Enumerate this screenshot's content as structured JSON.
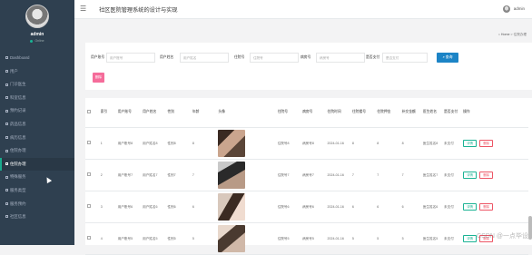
{
  "sidebar": {
    "profile": {
      "name": "admin",
      "status": "Online"
    },
    "items": [
      {
        "label": "Dashboard",
        "icon": "dashboard-icon"
      },
      {
        "label": "用户",
        "icon": "user-icon"
      },
      {
        "label": "门诊医生",
        "icon": "doctor-icon"
      },
      {
        "label": "科室信息",
        "icon": "building-icon"
      },
      {
        "label": "预约记录",
        "icon": "calendar-icon"
      },
      {
        "label": "药品信息",
        "icon": "medicine-icon"
      },
      {
        "label": "病历信息",
        "icon": "record-icon"
      },
      {
        "label": "住院办理",
        "icon": "bed-icon"
      },
      {
        "label": "住院办理",
        "icon": "bed-icon",
        "active": true
      },
      {
        "label": "特殊服务",
        "icon": "service-icon"
      },
      {
        "label": "服务类型",
        "icon": "list-icon"
      },
      {
        "label": "服务预约",
        "icon": "booking-icon"
      },
      {
        "label": "社区信息",
        "icon": "info-icon"
      }
    ]
  },
  "topbar": {
    "title": "社区医院管理系统的设计与实现",
    "user": "admin"
  },
  "breadcrumb": {
    "home": "Home",
    "current": "住院办理"
  },
  "search": {
    "fields": [
      {
        "label": "用户账号",
        "placeholder": "用户账号"
      },
      {
        "label": "用户姓名",
        "placeholder": "用户姓名"
      },
      {
        "label": "住院号",
        "placeholder": "住院号"
      },
      {
        "label": "病房号",
        "placeholder": "病房号"
      },
      {
        "label": "是否支付",
        "placeholder": "是否支付"
      }
    ],
    "search_label": "查询",
    "delete_label": "删除"
  },
  "table": {
    "headers": [
      "索引",
      "用户账号",
      "用户姓名",
      "性别",
      "年龄",
      "头像",
      "住院号",
      "病房号",
      "住院时间",
      "住院楼号",
      "住院押金",
      "补交金额",
      "医生姓名",
      "是否支付",
      "操作"
    ],
    "rows": [
      {
        "index": "1",
        "account": "用户账号8",
        "name": "用户姓名8",
        "gender": "性别8",
        "age": "8",
        "inpatient_no": "住院号8",
        "ward": "病房号8",
        "date": "2024-01-16",
        "building": "8",
        "deposit": "8",
        "extra": "8",
        "doctor": "医生姓名8",
        "paid": "未支付"
      },
      {
        "index": "2",
        "account": "用户账号7",
        "name": "用户姓名7",
        "gender": "性别7",
        "age": "7",
        "inpatient_no": "住院号7",
        "ward": "病房号7",
        "date": "2024-01-16",
        "building": "7",
        "deposit": "7",
        "extra": "7",
        "doctor": "医生姓名7",
        "paid": "未支付"
      },
      {
        "index": "3",
        "account": "用户账号6",
        "name": "用户姓名6",
        "gender": "性别6",
        "age": "6",
        "inpatient_no": "住院号6",
        "ward": "病房号6",
        "date": "2024-01-16",
        "building": "6",
        "deposit": "6",
        "extra": "6",
        "doctor": "医生姓名6",
        "paid": "未支付"
      },
      {
        "index": "4",
        "account": "用户账号5",
        "name": "用户姓名5",
        "gender": "性别5",
        "age": "5",
        "inpatient_no": "住院号5",
        "ward": "病房号5",
        "date": "2024-01-16",
        "building": "5",
        "deposit": "5",
        "extra": "5",
        "doctor": "医生姓名5",
        "paid": "未支付"
      }
    ],
    "detail_label": "详情",
    "delete_label": "删除"
  },
  "watermark": "CSDN @一点毕设",
  "colors": {
    "sidebar_bg": "#2f4050",
    "accent": "#1ab394",
    "primary": "#1c84c6",
    "danger": "#ed5565",
    "pink": "#f56c9a"
  }
}
